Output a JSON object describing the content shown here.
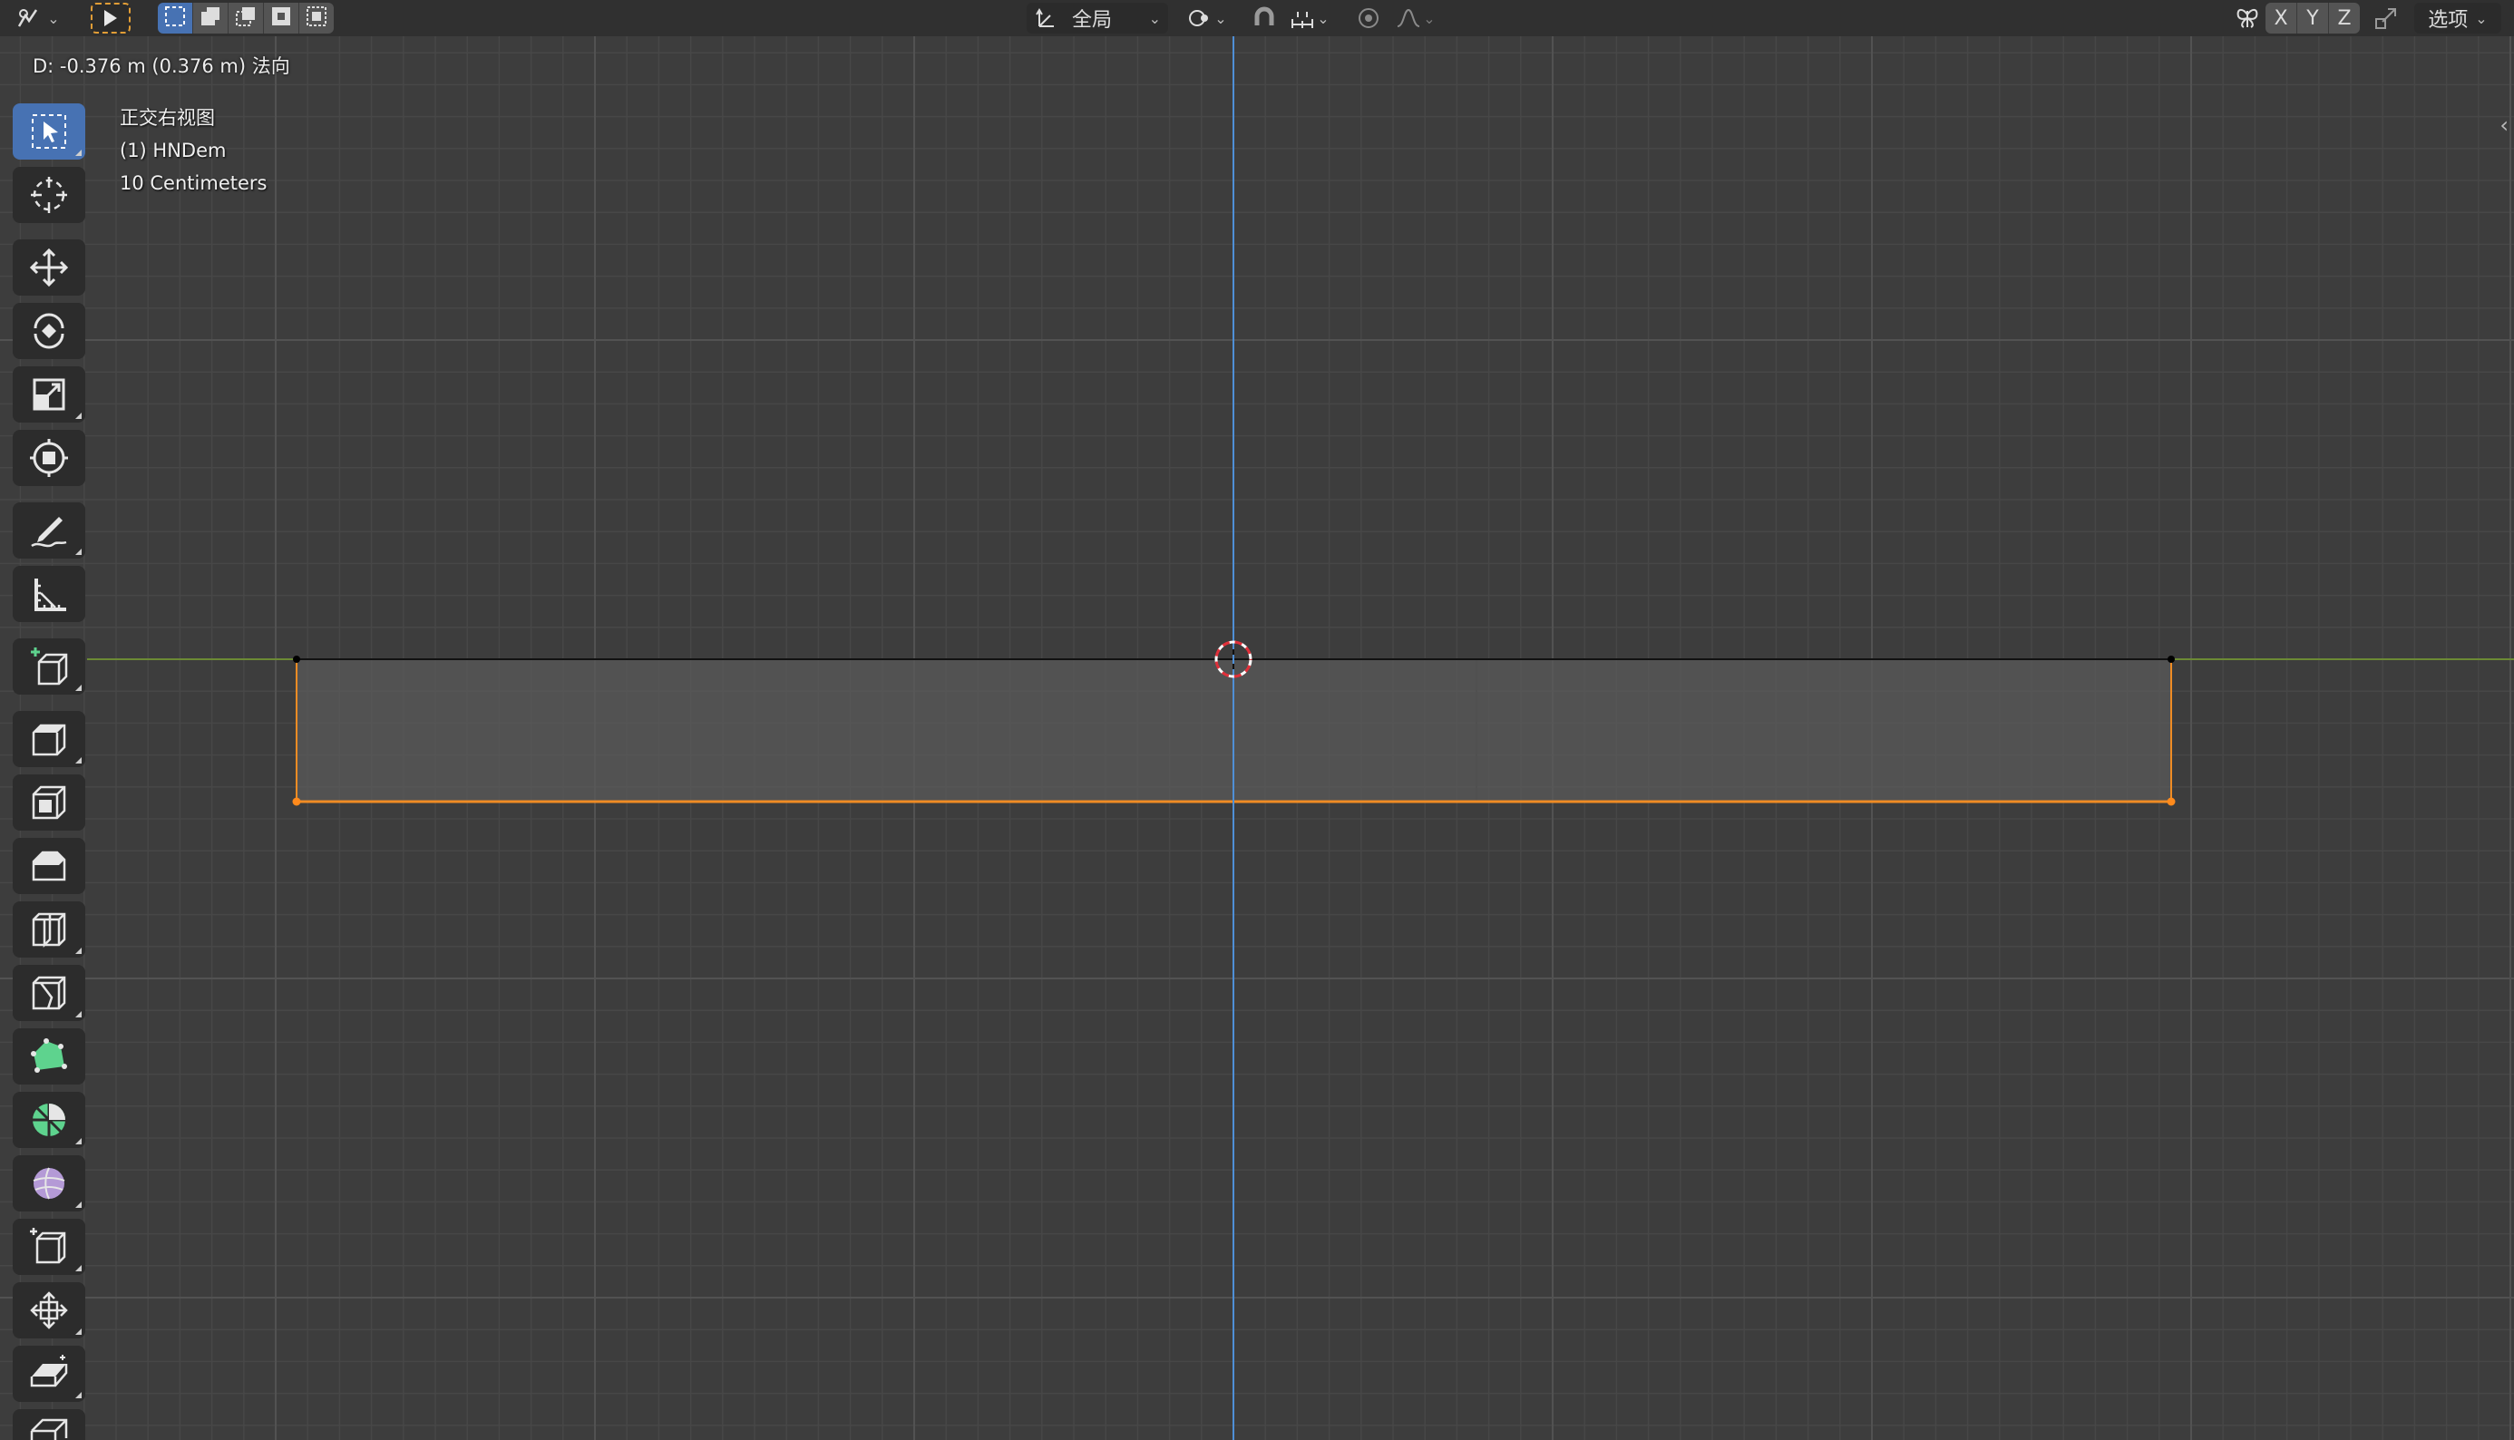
{
  "header": {
    "transform_orientation": "全局",
    "axis_x": "X",
    "axis_y": "Y",
    "axis_z": "Z",
    "options_label": "选项",
    "dropdown_arrow": "⌄"
  },
  "status": {
    "text": "D: -0.376 m (0.376 m) 法向"
  },
  "viewport": {
    "view_name": "正交右视图",
    "object_name": "(1) HNDem",
    "grid_scale": "10 Centimeters",
    "colors": {
      "background": "#3d3d3d",
      "grid_minor": "#474747",
      "grid_major": "#525252",
      "axis_y_green": "#6c8a35",
      "axis_z_blue": "#4f8fd6",
      "selected_edge": "#f08c24",
      "face_fill": "#5a5a5a"
    }
  },
  "toolbar": {
    "tools": [
      {
        "name": "select-box-tool",
        "icon": "select-box-icon",
        "active": true
      },
      {
        "name": "cursor-tool",
        "icon": "cursor-icon"
      },
      {
        "name": "move-tool",
        "icon": "move-icon"
      },
      {
        "name": "rotate-tool",
        "icon": "rotate-icon"
      },
      {
        "name": "scale-tool",
        "icon": "scale-icon"
      },
      {
        "name": "transform-tool",
        "icon": "transform-icon"
      },
      {
        "name": "annotate-tool",
        "icon": "annotate-icon"
      },
      {
        "name": "measure-tool",
        "icon": "measure-icon"
      },
      {
        "name": "add-cube-tool",
        "icon": "add-cube-icon"
      },
      {
        "name": "extrude-region-tool",
        "icon": "extrude-region-icon"
      },
      {
        "name": "inset-faces-tool",
        "icon": "inset-faces-icon"
      },
      {
        "name": "bevel-tool",
        "icon": "bevel-icon"
      },
      {
        "name": "loop-cut-tool",
        "icon": "loop-cut-icon"
      },
      {
        "name": "knife-tool",
        "icon": "knife-icon"
      },
      {
        "name": "poly-build-tool",
        "icon": "poly-build-icon"
      },
      {
        "name": "spin-tool",
        "icon": "spin-icon"
      },
      {
        "name": "smooth-tool",
        "icon": "smooth-icon"
      },
      {
        "name": "edge-slide-tool",
        "icon": "edge-slide-icon"
      },
      {
        "name": "shrink-fatten-tool",
        "icon": "shrink-fatten-icon"
      },
      {
        "name": "shear-tool",
        "icon": "shear-icon"
      },
      {
        "name": "rip-region-tool",
        "icon": "rip-region-icon"
      }
    ]
  }
}
